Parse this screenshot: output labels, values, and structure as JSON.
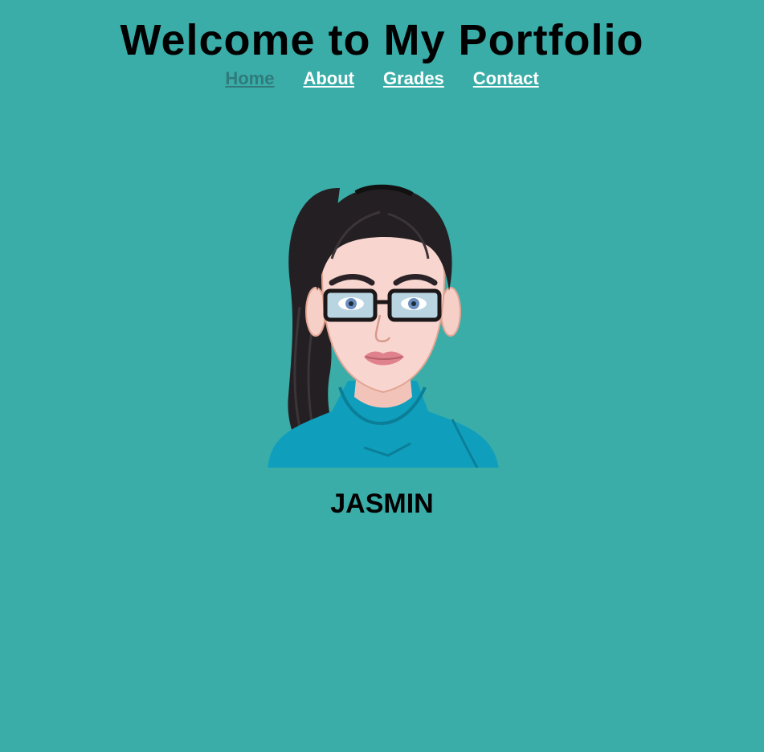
{
  "header": {
    "title": "Welcome to My Portfolio"
  },
  "nav": {
    "items": [
      {
        "label": "Home",
        "active": true
      },
      {
        "label": "About",
        "active": false
      },
      {
        "label": "Grades",
        "active": false
      },
      {
        "label": "Contact",
        "active": false
      }
    ]
  },
  "profile": {
    "name": "JASMIN",
    "avatar_icon": "cartoon-avatar-woman-with-glasses"
  },
  "colors": {
    "background": "#3aada8",
    "nav_link": "#ffffff",
    "nav_active": "#2f7b7b",
    "text": "#000000"
  }
}
